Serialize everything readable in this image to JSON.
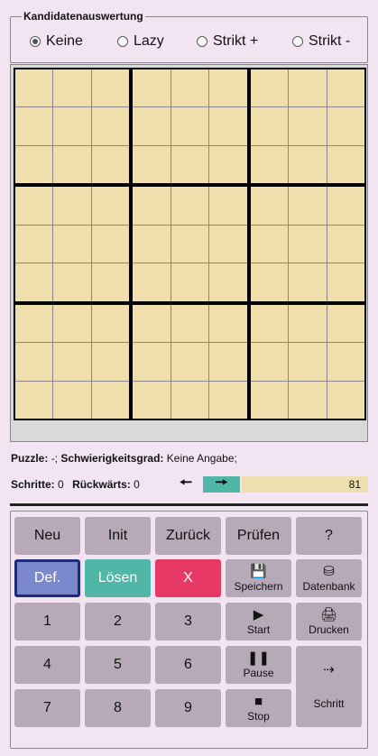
{
  "candidates": {
    "legend": "Kandidatenauswertung",
    "options": [
      {
        "label": "Keine",
        "selected": true
      },
      {
        "label": "Lazy",
        "selected": false
      },
      {
        "label": "Strikt +",
        "selected": false
      },
      {
        "label": "Strikt -",
        "selected": false
      }
    ]
  },
  "info": {
    "puzzle_label": "Puzzle:",
    "puzzle_value": "-;",
    "difficulty_label": "Schwierigkeitsgrad:",
    "difficulty_value": "Keine Angabe;",
    "steps_label": "Schritte:",
    "steps_value": "0",
    "backwards_label": "Rückwärts:",
    "backwards_value": "0"
  },
  "progress": {
    "value": "81"
  },
  "icons": {
    "left": "arrow-left-icon",
    "right": "arrow-right-icon"
  },
  "buttons": {
    "neu": "Neu",
    "init": "Init",
    "zurueck": "Zurück",
    "pruefen": "Prüfen",
    "help": "?",
    "def": "Def.",
    "loesen": "Lösen",
    "x": "X",
    "speichern": "Speichern",
    "datenbank": "Datenbank",
    "n1": "1",
    "n2": "2",
    "n3": "3",
    "start": "Start",
    "drucken": "Drucken",
    "n4": "4",
    "n5": "5",
    "n6": "6",
    "pause": "Pause",
    "n7": "7",
    "n8": "8",
    "n9": "9",
    "stop": "Stop",
    "schritt": "Schritt"
  },
  "colors": {
    "background": "#f3e4f2",
    "cell": "#f0deac",
    "button": "#b7a9b7",
    "def": "#7b89cc",
    "teal": "#4fb6a8",
    "red": "#e83966"
  }
}
